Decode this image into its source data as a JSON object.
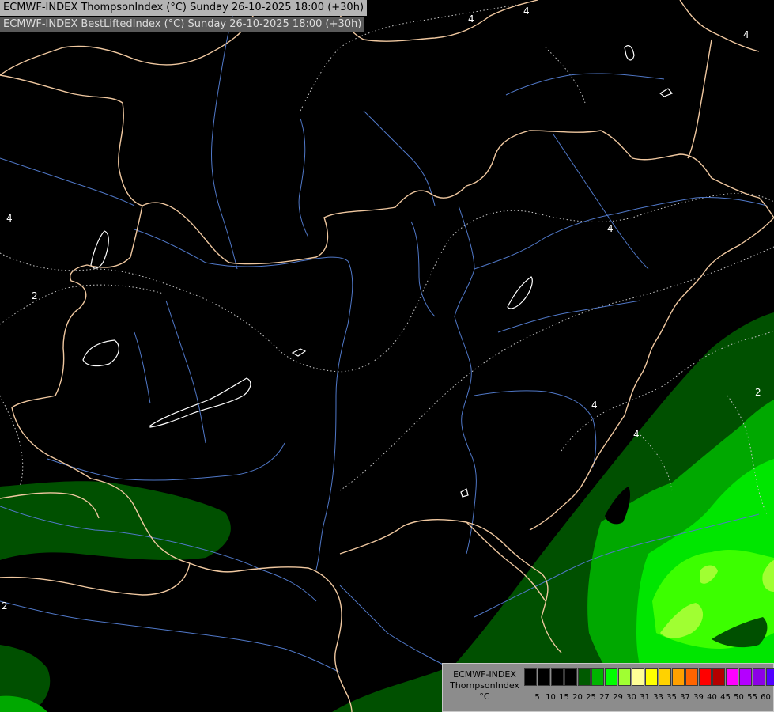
{
  "header": {
    "line1": "ECMWF-INDEX ThompsonIndex (°C) Sunday 26-10-2025 18:00 (+30h)",
    "line2": "ECMWF-INDEX BestLiftedIndex (°C) Sunday 26-10-2025 18:00 (+30h)"
  },
  "legend": {
    "model": "ECMWF-INDEX",
    "parameter": "ThompsonIndex",
    "unit": "°C",
    "colors": [
      "#000000",
      "#000000",
      "#000000",
      "#000000",
      "#005a00",
      "#00b400",
      "#00ff00",
      "#a0ff32",
      "#ffff96",
      "#ffff00",
      "#ffd200",
      "#ffa000",
      "#ff6400",
      "#ff0000",
      "#b40000",
      "#ff00ff",
      "#b400ff",
      "#8c00e6",
      "#5000ff",
      "#0000ff"
    ],
    "labels": [
      "5",
      "10",
      "15",
      "20",
      "25",
      "27",
      "29",
      "30",
      "31",
      "33",
      "35",
      "37",
      "39",
      "40",
      "45",
      "50",
      "55",
      "60"
    ]
  },
  "contours": {
    "labels": [
      "4",
      "4",
      "2",
      "4",
      "4",
      "2",
      "4",
      "4",
      "4",
      "2"
    ]
  },
  "colors": {
    "background": "#000000",
    "dark_green": "#005000",
    "mid_green": "#00a800",
    "bright_green": "#00e600",
    "lime": "#64ff00",
    "yellow_green": "#a0ff32",
    "border": "#f0c8a0",
    "river": "#5078c8",
    "contour": "#c8c8c8"
  }
}
